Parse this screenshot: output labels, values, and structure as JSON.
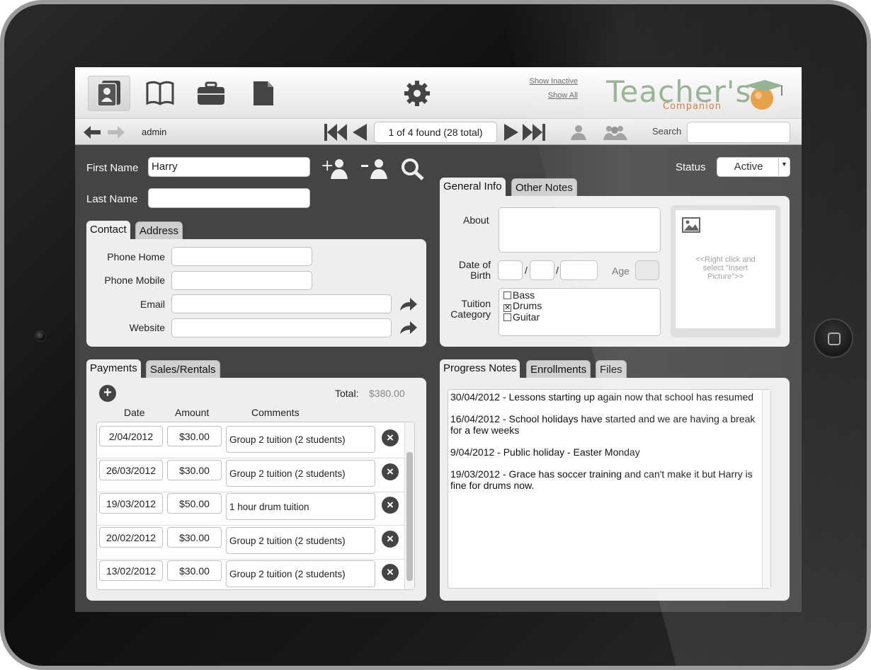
{
  "toolbar": {
    "icons": [
      "contacts-icon",
      "book-icon",
      "briefcase-icon",
      "document-icon",
      "gear-icon"
    ],
    "link_show_inactive": "Show Inactive",
    "link_show_all": "Show All",
    "logo_title": "Teacher's",
    "logo_subtitle": "Companion"
  },
  "navbar": {
    "user": "admin",
    "record_count": "1 of 4 found (28 total)",
    "search_label": "Search",
    "search_value": ""
  },
  "student": {
    "first_name_label": "First Name",
    "first_name": "Harry",
    "last_name_label": "Last Name",
    "last_name": "",
    "status_label": "Status",
    "status": "Active"
  },
  "contact": {
    "tabs": [
      "Contact",
      "Address"
    ],
    "phone_home_label": "Phone Home",
    "phone_mobile_label": "Phone Mobile",
    "email_label": "Email",
    "website_label": "Website",
    "phone_home": "",
    "phone_mobile": "",
    "email": "",
    "website": ""
  },
  "general": {
    "tabs": [
      "General Info",
      "Other Notes"
    ],
    "about_label": "About",
    "about": "",
    "dob_label_1": "Date of",
    "dob_label_2": "Birth",
    "dob_sep": "/",
    "age_label": "Age",
    "tuition_label_1": "Tuition",
    "tuition_label_2": "Category",
    "categories": [
      {
        "name": "Bass",
        "checked": false
      },
      {
        "name": "Drums",
        "checked": true
      },
      {
        "name": "Guitar",
        "checked": false
      }
    ],
    "picture_hint": "<<Right click and select \"Insert Picture\">>"
  },
  "payments": {
    "tabs": [
      "Payments",
      "Sales/Rentals"
    ],
    "total_label": "Total:",
    "total_value": "$380.00",
    "col_date": "Date",
    "col_amount": "Amount",
    "col_comments": "Comments",
    "rows": [
      {
        "date": "2/04/2012",
        "amount": "$30.00",
        "comment": "Group 2 tuition (2 students)"
      },
      {
        "date": "26/03/2012",
        "amount": "$30.00",
        "comment": "Group 2 tuition (2 students)"
      },
      {
        "date": "19/03/2012",
        "amount": "$50.00",
        "comment": "1 hour drum tuition"
      },
      {
        "date": "20/02/2012",
        "amount": "$30.00",
        "comment": "Group 2 tuition (2 students)"
      },
      {
        "date": "13/02/2012",
        "amount": "$30.00",
        "comment": "Group 2 tuition (2 students)"
      }
    ]
  },
  "progress": {
    "tabs": [
      "Progress Notes",
      "Enrollments",
      "Files"
    ],
    "notes": [
      "30/04/2012 - Lessons starting up again now that school has resumed",
      "16/04/2012 - School holidays have started and we are having a break for a few weeks",
      "9/04/2012 - Public holiday - Easter Monday",
      "19/03/2012 - Grace has soccer training and can't make it but Harry is fine for drums now."
    ]
  }
}
